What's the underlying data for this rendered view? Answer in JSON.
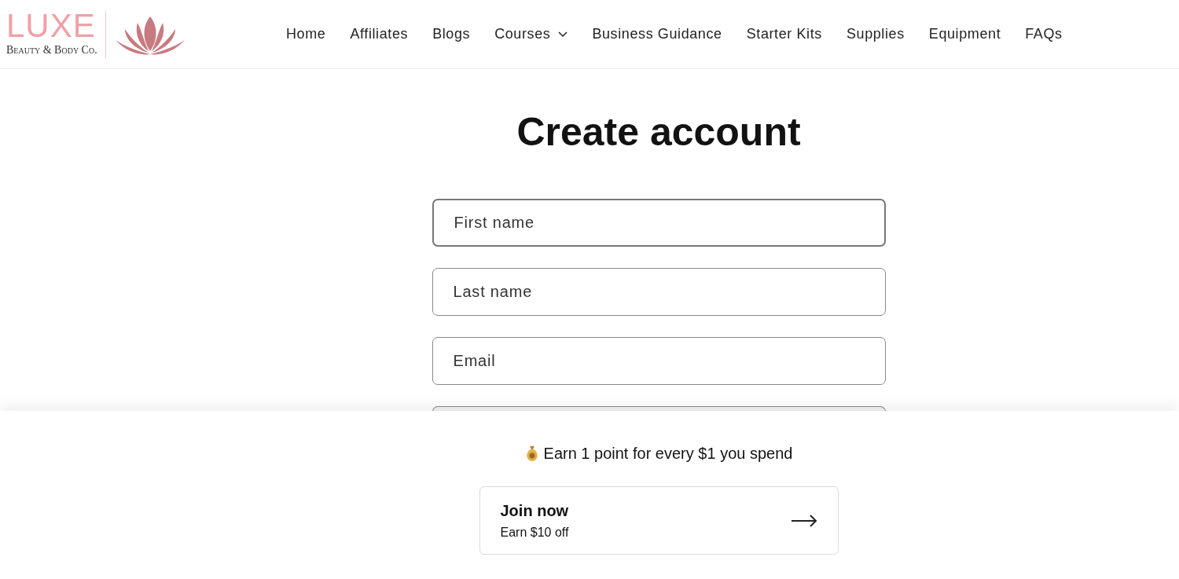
{
  "logo": {
    "wordmark": "LUXE",
    "tagline": "Beauty & Body Co."
  },
  "nav": [
    {
      "label": "Home",
      "dropdown": false
    },
    {
      "label": "Affiliates",
      "dropdown": false
    },
    {
      "label": "Blogs",
      "dropdown": false
    },
    {
      "label": "Courses",
      "dropdown": true
    },
    {
      "label": "Business Guidance",
      "dropdown": false
    },
    {
      "label": "Starter Kits",
      "dropdown": false
    },
    {
      "label": "Supplies",
      "dropdown": false
    },
    {
      "label": "Equipment",
      "dropdown": false
    },
    {
      "label": "FAQs",
      "dropdown": false
    }
  ],
  "heading": "Create account",
  "fields": [
    {
      "placeholder": "First name",
      "focused": true
    },
    {
      "placeholder": "Last name",
      "focused": false
    },
    {
      "placeholder": "Email",
      "focused": false
    },
    {
      "focused": false
    }
  ],
  "rewards": {
    "message": "Earn 1 point for every $1 you spend",
    "join": {
      "title": "Join now",
      "subtitle": "Earn $10 off"
    }
  }
}
